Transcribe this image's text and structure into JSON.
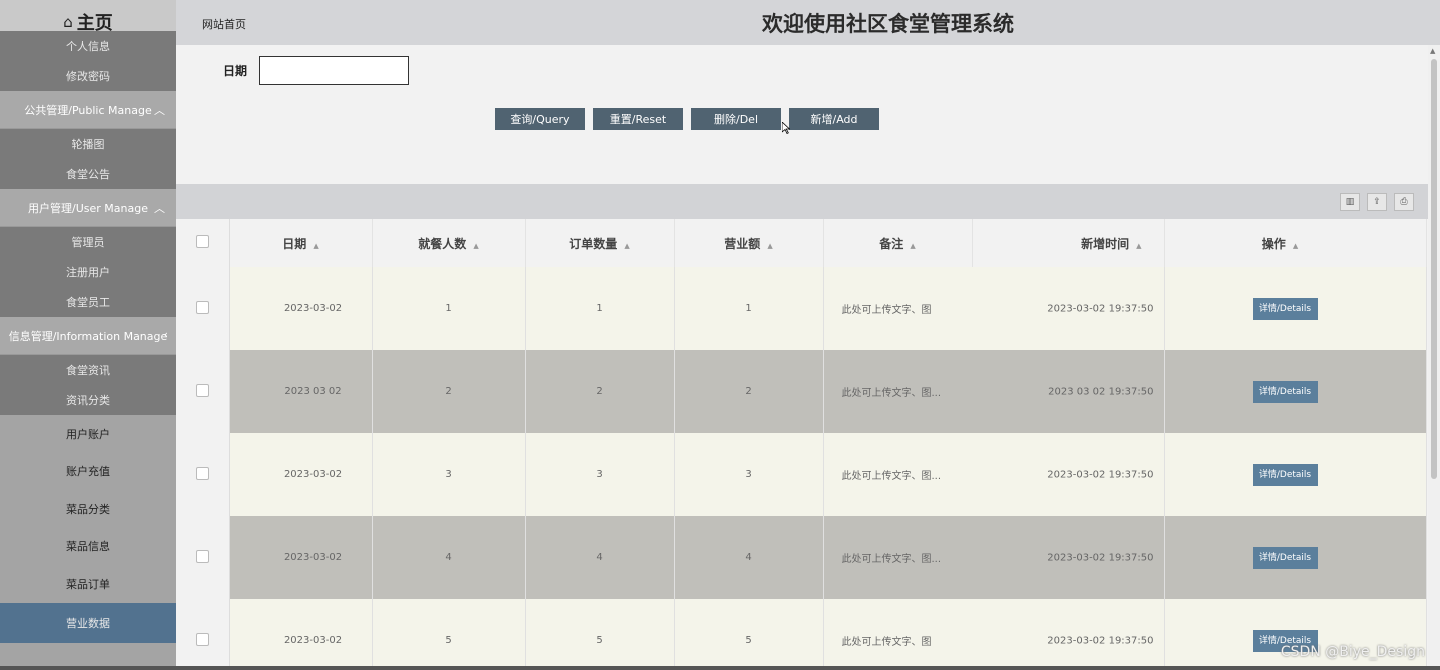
{
  "header": {
    "home_label": "主页",
    "nav_link": "网站首页",
    "title": "欢迎使用社区食堂管理系统"
  },
  "sidebar": {
    "top_items": [
      "个人信息",
      "修改密码"
    ],
    "groups": [
      {
        "label": "公共管理/Public Manage",
        "items": [
          "轮播图",
          "食堂公告"
        ]
      },
      {
        "label": "用户管理/User Manage",
        "items": [
          "管理员",
          "注册用户",
          "食堂员工"
        ]
      },
      {
        "label": "信息管理/Information Manage",
        "items": [
          "食堂资讯",
          "资讯分类"
        ]
      }
    ],
    "items": [
      "用户账户",
      "账户充值",
      "菜品分类",
      "菜品信息",
      "菜品订单",
      "营业数据"
    ],
    "active_item": "营业数据"
  },
  "filter": {
    "date_label": "日期",
    "date_value": ""
  },
  "buttons": {
    "query": "查询/Query",
    "reset": "重置/Reset",
    "delete": "删除/Del",
    "add": "新增/Add"
  },
  "table": {
    "columns": [
      "日期",
      "就餐人数",
      "订单数量",
      "营业额",
      "备注",
      "新增时间",
      "操作"
    ],
    "detail_label": "详情/Details",
    "rows": [
      {
        "date": "2023-03-02",
        "diners": "1",
        "orders": "1",
        "revenue": "1",
        "note": "此处可上传文字、图",
        "created": "2023-03-02 19:37:50"
      },
      {
        "date": "2023 03 02",
        "diners": "2",
        "orders": "2",
        "revenue": "2",
        "note": "此处可上传文字、图...",
        "created": "2023 03 02 19:37:50"
      },
      {
        "date": "2023-03-02",
        "diners": "3",
        "orders": "3",
        "revenue": "3",
        "note": "此处可上传文字、图...",
        "created": "2023-03-02 19:37:50"
      },
      {
        "date": "2023-03-02",
        "diners": "4",
        "orders": "4",
        "revenue": "4",
        "note": "此处可上传文字、图...",
        "created": "2023-03-02 19:37:50"
      },
      {
        "date": "2023-03-02",
        "diners": "5",
        "orders": "5",
        "revenue": "5",
        "note": "此处可上传文字、图",
        "created": "2023-03-02 19:37:50"
      }
    ]
  },
  "watermark": "CSDN @Biye_Design",
  "colors": {
    "active": "#52728f",
    "button": "#506371",
    "detail": "#5b7f9c"
  }
}
